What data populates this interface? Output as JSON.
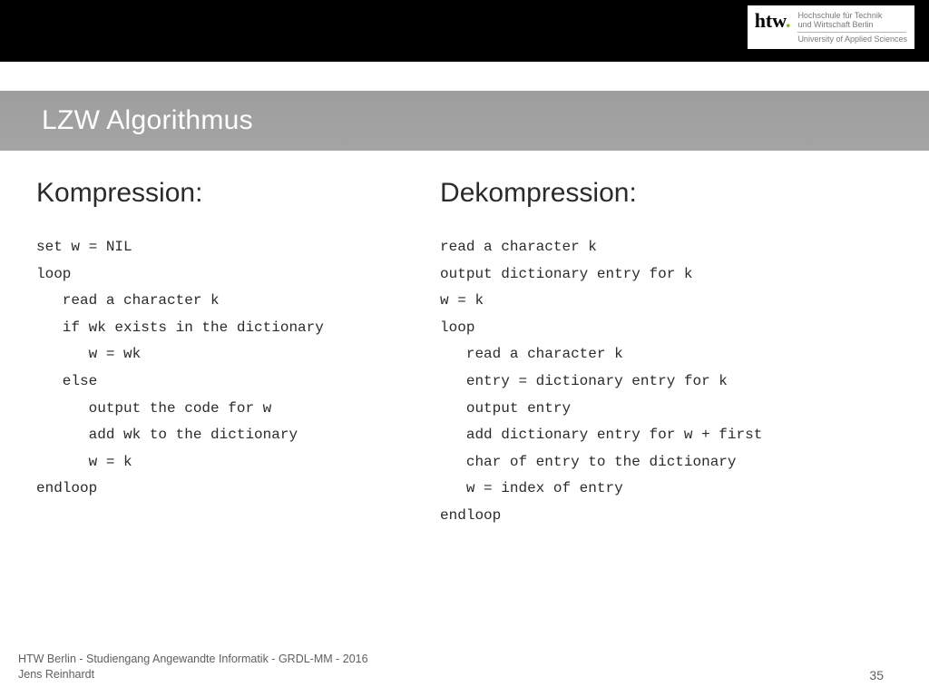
{
  "brand": {
    "logo_prefix": "htw",
    "logo_dot": ".",
    "line1": "Hochschule für Technik",
    "line2": "und Wirtschaft Berlin",
    "line3": "University of Applied Sciences"
  },
  "title": "LZW Algorithmus",
  "columns": {
    "left": {
      "heading": "Kompression:",
      "code": "set w = NIL\nloop\n   read a character k\n   if wk exists in the dictionary\n      w = wk\n   else\n      output the code for w\n      add wk to the dictionary\n      w = k\nendloop"
    },
    "right": {
      "heading": "Dekompression:",
      "code": "read a character k\noutput dictionary entry for k\nw = k\nloop\n   read a character k\n   entry = dictionary entry for k\n   output entry\n   add dictionary entry for w + first\n   char of entry to the dictionary\n   w = index of entry\nendloop"
    }
  },
  "footer": {
    "line1": "HTW Berlin - Studiengang Angewandte Informatik - GRDL-MM - 2016",
    "line2": "Jens Reinhardt",
    "page": "35"
  }
}
